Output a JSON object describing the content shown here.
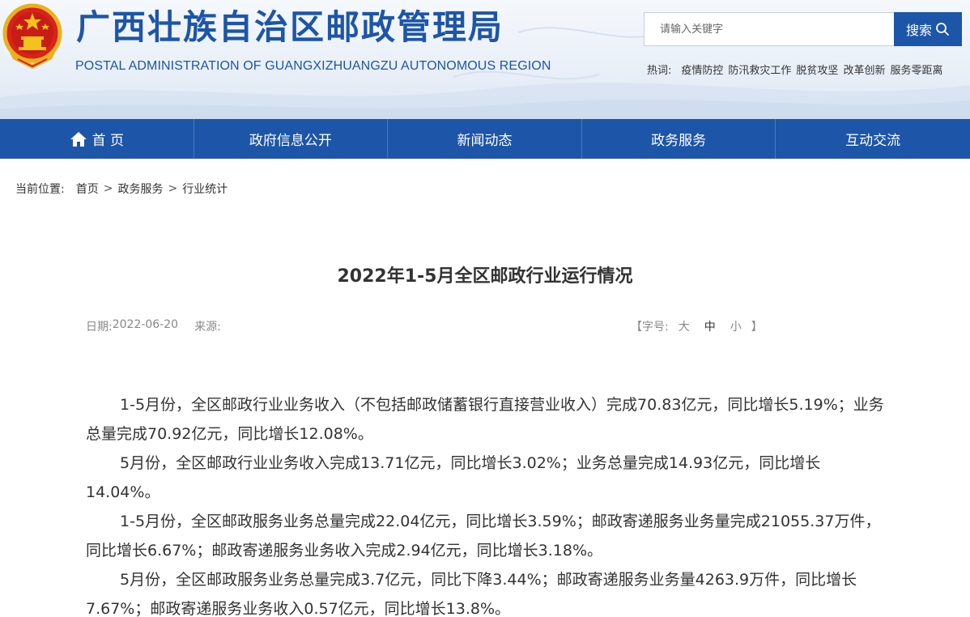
{
  "header": {
    "title": "广西壮族自治区邮政管理局",
    "subtitle": "POSTAL ADMINISTRATION OF GUANGXIZHUANGZU AUTONOMOUS REGION",
    "search_placeholder": "请输入关键字",
    "search_button": "搜索",
    "hotwords_label": "热词:",
    "hotwords": [
      "疫情防控",
      "防汛救灾工作",
      "脱贫攻坚",
      "改革创新",
      "服务零距离"
    ]
  },
  "nav": {
    "items": [
      {
        "label": "首 页",
        "icon": "home-icon"
      },
      {
        "label": "政府信息公开"
      },
      {
        "label": "新闻动态"
      },
      {
        "label": "政务服务"
      },
      {
        "label": "互动交流"
      }
    ]
  },
  "breadcrumb": {
    "label": "当前位置:",
    "items": [
      "首页",
      "政务服务",
      "行业统计"
    ],
    "separator": ">"
  },
  "article": {
    "title": "2022年1-5月全区邮政行业运行情况",
    "date_label": "日期:",
    "date": "2022-06-20",
    "source_label": "来源:",
    "source": "",
    "fontsize_open": "【字号:",
    "fontsize_options": [
      "大",
      "中",
      "小"
    ],
    "fontsize_close": "】",
    "paragraphs": [
      "1-5月份，全区邮政行业业务收入（不包括邮政储蓄银行直接营业收入）完成70.83亿元，同比增长5.19%；业务总量完成70.92亿元，同比增长12.08%。",
      "5月份，全区邮政行业业务收入完成13.71亿元，同比增长3.02%；业务总量完成14.93亿元，同比增长14.04%。",
      "1-5月份，全区邮政服务业务总量完成22.04亿元，同比增长3.59%；邮政寄递服务业务量完成21055.37万件，同比增长6.67%；邮政寄递服务业务收入完成2.94亿元，同比增长3.18%。",
      "5月份，全区邮政服务业务总量完成3.7亿元，同比下降3.44%；邮政寄递服务业务量4263.9万件，同比增长7.67%；邮政寄递服务业务收入0.57亿元，同比增长13.8%。"
    ]
  },
  "colors": {
    "brand_blue": "#1d55a8",
    "text": "#333333",
    "muted": "#888888"
  }
}
